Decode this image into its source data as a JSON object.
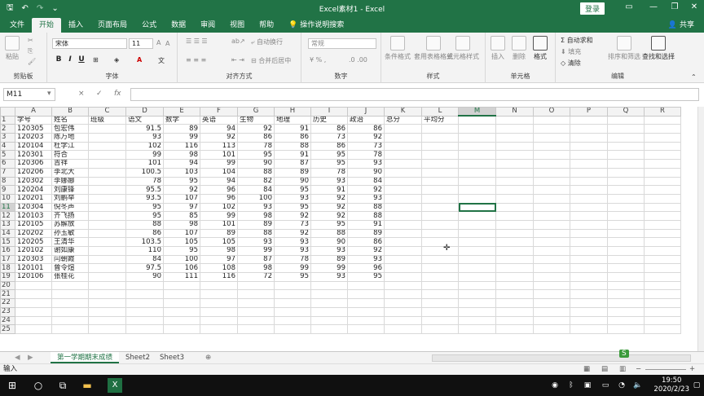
{
  "titlebar": {
    "title": "Excel素材1 - Excel",
    "login": "登录",
    "save_icon": "save-icon",
    "undo_icon": "undo-icon",
    "redo_icon": "redo-icon"
  },
  "menu": {
    "tabs": [
      "文件",
      "开始",
      "插入",
      "页面布局",
      "公式",
      "数据",
      "审阅",
      "视图",
      "帮助",
      "操作说明搜索"
    ],
    "share": "共享"
  },
  "ribbon": {
    "clipboard": {
      "label": "剪贴板",
      "paste": "粘贴"
    },
    "font": {
      "label": "字体",
      "name": "宋体",
      "size": "11"
    },
    "alignment": {
      "label": "对齐方式",
      "wrap": "自动换行",
      "merge": "合并后居中"
    },
    "number": {
      "label": "数字",
      "format": "常规"
    },
    "styles": {
      "label": "样式",
      "cond": "条件格式",
      "table": "套用表格格式",
      "cell": "单元格样式"
    },
    "cells": {
      "label": "单元格",
      "insert": "插入",
      "delete": "删除",
      "format": "格式"
    },
    "editing": {
      "label": "编辑",
      "autosum": "自动求和",
      "fill": "填充",
      "clear": "清除",
      "sort": "排序和筛选",
      "find": "查找和选择"
    }
  },
  "formula_bar": {
    "namebox": "M11",
    "cancel": "×",
    "enter": "✓",
    "fx": "fx",
    "value": ""
  },
  "grid": {
    "columns": [
      "A",
      "B",
      "C",
      "D",
      "E",
      "F",
      "G",
      "H",
      "I",
      "J",
      "K",
      "L",
      "M",
      "N",
      "O",
      "P",
      "Q",
      "R"
    ],
    "selected_column": "M",
    "selected_row": 11,
    "header_row": [
      "学号",
      "姓名",
      "班级",
      "语文",
      "数学",
      "英语",
      "生物",
      "地理",
      "历史",
      "政治",
      "总分",
      "平均分"
    ],
    "rows": [
      [
        "120305",
        "包宏伟",
        "",
        "91.5",
        "89",
        "94",
        "92",
        "91",
        "86",
        "86"
      ],
      [
        "120203",
        "陈万地",
        "",
        "93",
        "99",
        "92",
        "86",
        "86",
        "73",
        "92"
      ],
      [
        "120104",
        "杜学江",
        "",
        "102",
        "116",
        "113",
        "78",
        "88",
        "86",
        "73"
      ],
      [
        "120301",
        "符合",
        "",
        "99",
        "98",
        "101",
        "95",
        "91",
        "95",
        "78"
      ],
      [
        "120306",
        "吉祥",
        "",
        "101",
        "94",
        "99",
        "90",
        "87",
        "95",
        "93"
      ],
      [
        "120206",
        "李北大",
        "",
        "100.5",
        "103",
        "104",
        "88",
        "89",
        "78",
        "90"
      ],
      [
        "120302",
        "李娜娜",
        "",
        "78",
        "95",
        "94",
        "82",
        "90",
        "93",
        "84"
      ],
      [
        "120204",
        "刘康锋",
        "",
        "95.5",
        "92",
        "96",
        "84",
        "95",
        "91",
        "92"
      ],
      [
        "120201",
        "刘鹏举",
        "",
        "93.5",
        "107",
        "96",
        "100",
        "93",
        "92",
        "93"
      ],
      [
        "120304",
        "倪冬声",
        "",
        "95",
        "97",
        "102",
        "93",
        "95",
        "92",
        "88"
      ],
      [
        "120103",
        "齐飞扬",
        "",
        "95",
        "85",
        "99",
        "98",
        "92",
        "92",
        "88"
      ],
      [
        "120105",
        "苏解放",
        "",
        "88",
        "98",
        "101",
        "89",
        "73",
        "95",
        "91"
      ],
      [
        "120202",
        "孙玉敏",
        "",
        "86",
        "107",
        "89",
        "88",
        "92",
        "88",
        "89"
      ],
      [
        "120205",
        "王清华",
        "",
        "103.5",
        "105",
        "105",
        "93",
        "93",
        "90",
        "86"
      ],
      [
        "120102",
        "谢如康",
        "",
        "110",
        "95",
        "98",
        "99",
        "93",
        "93",
        "92"
      ],
      [
        "120303",
        "闫朝霞",
        "",
        "84",
        "100",
        "97",
        "87",
        "78",
        "89",
        "93"
      ],
      [
        "120101",
        "曾令煊",
        "",
        "97.5",
        "106",
        "108",
        "98",
        "99",
        "99",
        "96"
      ],
      [
        "120106",
        "张桂花",
        "",
        "90",
        "111",
        "116",
        "72",
        "95",
        "93",
        "95"
      ]
    ],
    "row_count": 25
  },
  "sheets": {
    "tabs": [
      "第一学期期末成绩",
      "Sheet2",
      "Sheet3"
    ],
    "add": "⊕"
  },
  "status": {
    "mode": "输入"
  },
  "taskbar": {
    "time": "19:50",
    "date": "2020/2/23"
  }
}
